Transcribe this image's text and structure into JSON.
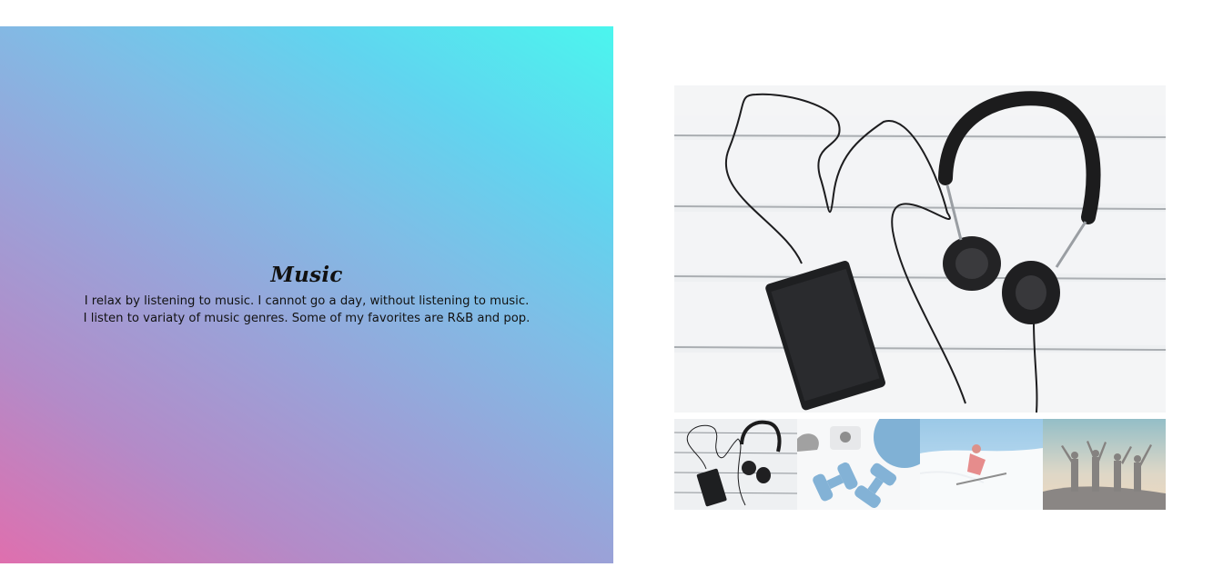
{
  "hero": {
    "title": "Music",
    "text_line1": "I relax by listening to music. I cannot go a day, without listening to music.",
    "text_line2": "I listen to variaty of music genres. Some of my favorites are R&B and pop."
  },
  "gallery": {
    "main_image": "headphones-and-phone-photo",
    "thumbnails": [
      {
        "image": "headphones-and-phone-photo",
        "active": true
      },
      {
        "image": "dumbbells-photo",
        "active": false
      },
      {
        "image": "skier-photo",
        "active": false
      },
      {
        "image": "friends-silhouette-photo",
        "active": false
      }
    ]
  },
  "colors": {
    "gradient_start": "#df6fae",
    "gradient_mid": "#9aa2d8",
    "gradient_end": "#4bf6ee"
  }
}
